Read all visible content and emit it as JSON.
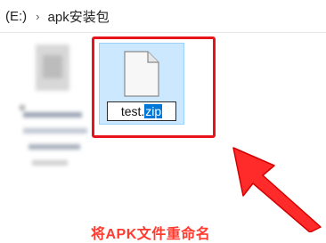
{
  "address_bar": {
    "drive": "(E:)",
    "separator": "›",
    "folder": "apk安装包"
  },
  "file": {
    "name_part": "test.",
    "extension_selected": "zip",
    "icon": "file-icon"
  },
  "annotation": {
    "caption": "将APK文件重命名",
    "frame_color": "#e8141b",
    "arrow_color": "#ff2a2a"
  }
}
